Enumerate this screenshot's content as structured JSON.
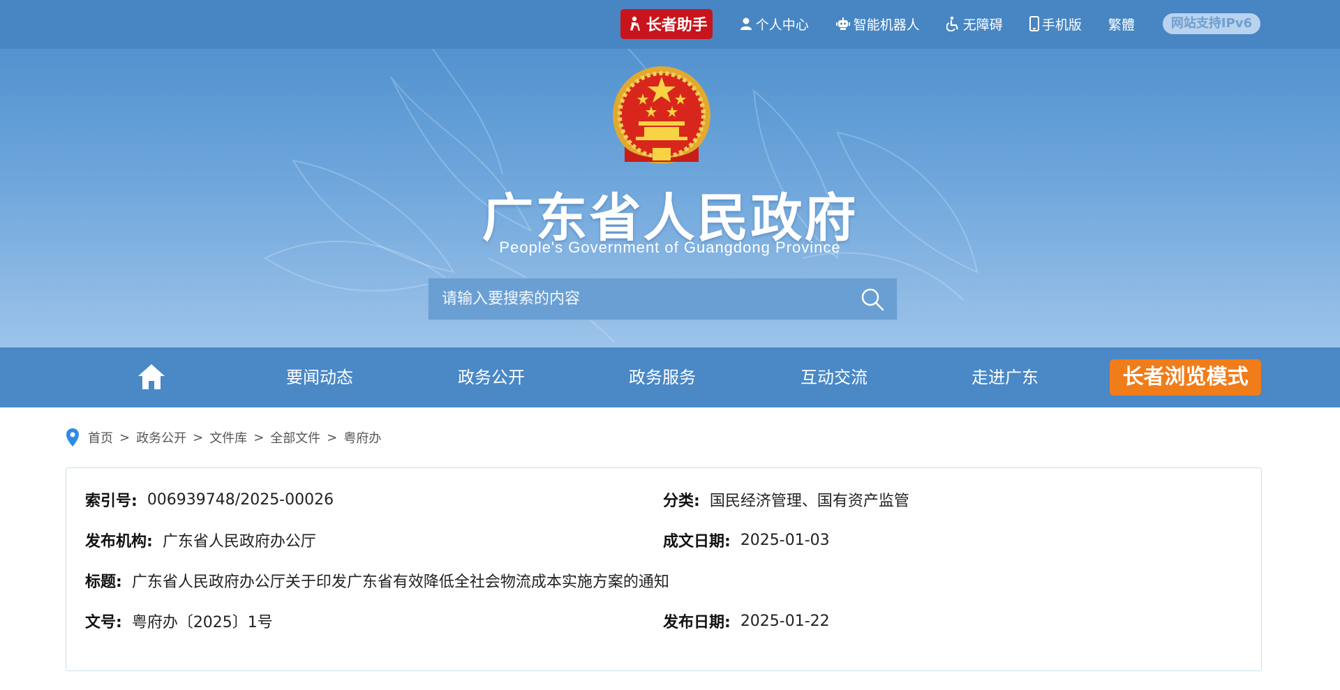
{
  "topbar": {
    "elder_helper": "长者助手",
    "links": [
      "个人中心",
      "智能机器人",
      "无障碍",
      "手机版",
      "繁體"
    ],
    "ipv6": "网站支持IPv6"
  },
  "banner": {
    "title": "广东省人民政府",
    "subtitle": "People's Government of Guangdong Province",
    "search_placeholder": "请输入要搜索的内容"
  },
  "nav": {
    "items": [
      "要闻动态",
      "政务公开",
      "政务服务",
      "互动交流",
      "走进广东"
    ],
    "elder_mode": "长者浏览模式"
  },
  "breadcrumb": [
    "首页",
    "政务公开",
    "文件库",
    "全部文件",
    "粤府办"
  ],
  "breadcrumb_sep": ">",
  "info": {
    "index_label": "索引号:",
    "index_value": "006939748/2025-00026",
    "category_label": "分类:",
    "category_value": "国民经济管理、国有资产监管",
    "issuer_label": "发布机构:",
    "issuer_value": "广东省人民政府办公厅",
    "created_label": "成文日期:",
    "created_value": "2025-01-03",
    "title_label": "标题:",
    "title_value": "广东省人民政府办公厅关于印发广东省有效降低全社会物流成本实施方案的通知",
    "docno_label": "文号:",
    "docno_value": "粤府办〔2025〕1号",
    "published_label": "发布日期:",
    "published_value": "2025-01-22"
  },
  "colors": {
    "topbar": "#4886c3",
    "nav": "#4a88c6",
    "elder_helper": "#c8151d",
    "elder_mode": "#f07c1a",
    "panel_border": "#c9dfe8"
  },
  "icons": [
    "elder-helper-icon",
    "user-icon",
    "robot-icon",
    "accessibility-icon",
    "mobile-icon",
    "national-emblem",
    "search-icon",
    "home-icon",
    "location-pin-icon"
  ]
}
